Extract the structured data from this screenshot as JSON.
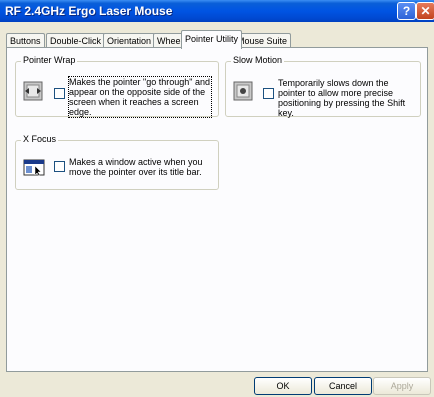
{
  "window": {
    "title": "RF 2.4GHz Ergo Laser Mouse",
    "help_label": "?",
    "close_label": "✕"
  },
  "tabs": [
    {
      "label": "Buttons"
    },
    {
      "label": "Double-Click"
    },
    {
      "label": "Orientation"
    },
    {
      "label": "Wheel"
    },
    {
      "label": "Pointer Utility",
      "active": true
    },
    {
      "label": "Mouse Suite"
    }
  ],
  "pointer_wrap": {
    "label": "Pointer Wrap",
    "checked": false,
    "description": "Makes the pointer \"go through\" and appear on the opposite side of the screen when it reaches a screen edge."
  },
  "slow_motion": {
    "label": "Slow Motion",
    "checked": false,
    "description": "Temporarily slows down the pointer to allow more precise positioning by pressing the Shift key."
  },
  "x_focus": {
    "label": "X Focus",
    "checked": false,
    "description": "Makes a window active when you move the pointer over its title bar."
  },
  "buttons": {
    "ok": "OK",
    "cancel": "Cancel",
    "apply": "Apply"
  },
  "icons": {
    "pointer_wrap": "pointer-wrap-icon",
    "slow_motion": "slow-motion-icon",
    "x_focus": "window-focus-icon"
  }
}
